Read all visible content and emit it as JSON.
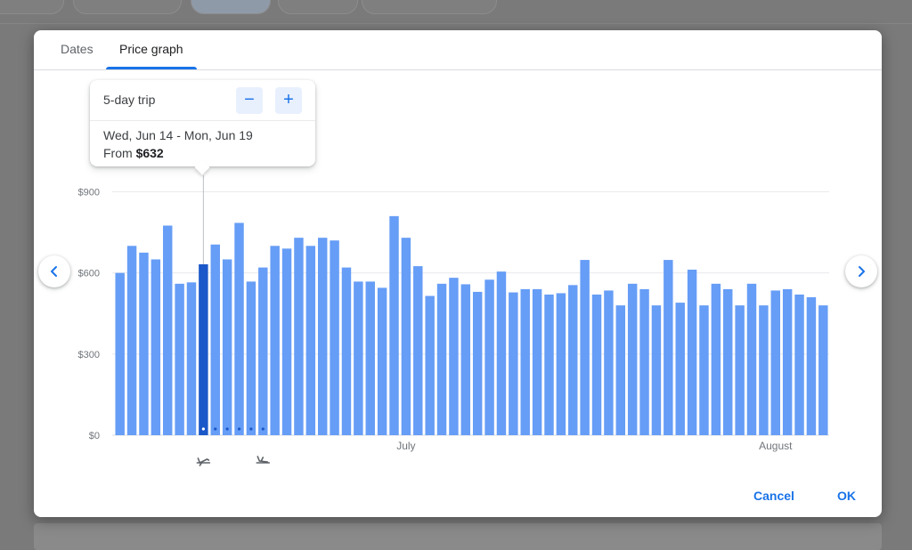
{
  "dialog": {
    "tabs": [
      {
        "label": "Dates",
        "active": false
      },
      {
        "label": "Price graph",
        "active": true
      }
    ],
    "popup": {
      "trip_length": "5-day trip",
      "minus_symbol": "−",
      "plus_symbol": "+",
      "dates": "Wed, Jun 14 - Mon, Jun 19",
      "price_prefix": "From",
      "price": "$632"
    },
    "footer": {
      "cancel": "Cancel",
      "ok": "OK"
    },
    "icons": {
      "prev": "chevron-left-icon",
      "next": "chevron-right-icon",
      "departure": "flight-takeoff-icon",
      "return": "flight-land-icon"
    }
  },
  "colors": {
    "bar": "#669df6",
    "bar_selected": "#1a57c8",
    "accent": "#1a73e8"
  },
  "chart_data": {
    "type": "bar",
    "title": "",
    "xlabel": "",
    "ylabel": "",
    "y_ticks": [
      "$0",
      "$300",
      "$600",
      "$900"
    ],
    "ylim": [
      0,
      900
    ],
    "month_labels": [
      {
        "label": "July",
        "index": 24
      },
      {
        "label": "August",
        "index": 55
      }
    ],
    "selected_index": 7,
    "trip_dots": 6,
    "values": [
      600,
      700,
      675,
      650,
      775,
      560,
      565,
      632,
      705,
      650,
      785,
      568,
      620,
      700,
      690,
      730,
      700,
      730,
      720,
      620,
      568,
      568,
      545,
      810,
      730,
      625,
      515,
      560,
      582,
      558,
      530,
      575,
      605,
      528,
      540,
      540,
      520,
      525,
      555,
      648,
      520,
      535,
      480,
      560,
      540,
      480,
      648,
      490,
      612,
      480,
      560,
      540,
      480,
      560,
      480,
      535,
      540,
      520,
      510,
      480
    ],
    "grid": true,
    "legend": "none"
  }
}
